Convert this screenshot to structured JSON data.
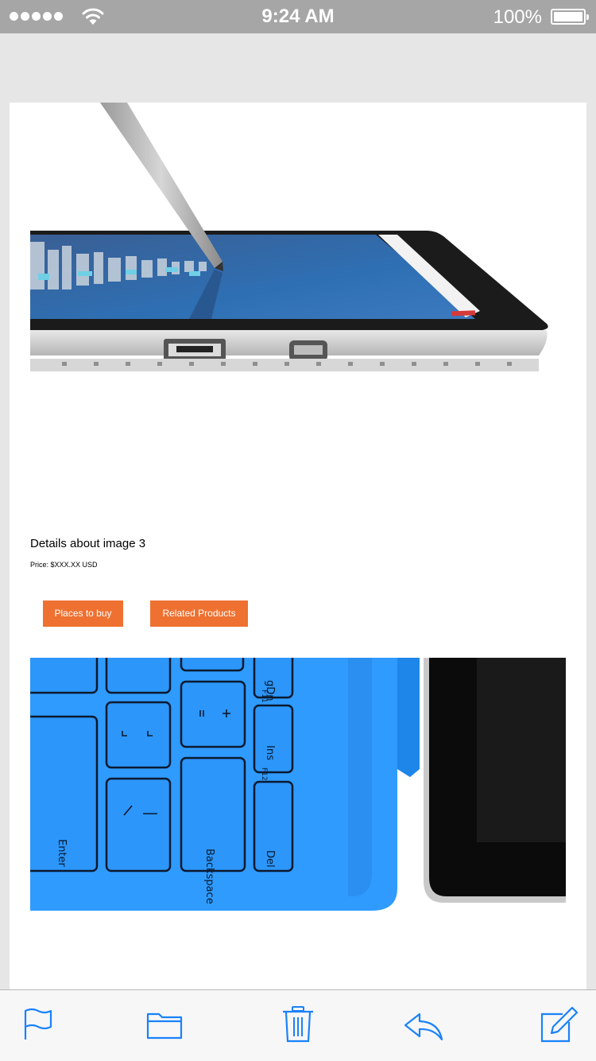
{
  "status_bar": {
    "time": "9:24 AM",
    "battery_percent": "100%",
    "battery_level": 1.0,
    "signal_icon": "signal-dots-icon",
    "wifi_icon": "wifi-icon",
    "battery_icon": "battery-icon"
  },
  "product": {
    "image1_icon": "tablet-with-pen-image",
    "details_title": "Details about image 3",
    "price": "Price: $XXX.XX USD",
    "places_button": "Places to buy",
    "related_button": "Related Products",
    "image2_icon": "keyboard-cover-image",
    "keyboard_keys": {
      "enter": "Enter",
      "backspace": "Backspace",
      "del": "Del",
      "ins": "Ins",
      "f12": "F12",
      "f11": "F11",
      "pgdn": "gDn"
    }
  },
  "toolbar": {
    "items": [
      {
        "icon": "flag-icon"
      },
      {
        "icon": "folder-icon"
      },
      {
        "icon": "trash-icon"
      },
      {
        "icon": "reply-icon"
      },
      {
        "icon": "compose-icon"
      }
    ]
  },
  "colors": {
    "accent": "#1a82fb",
    "button": "#ee7131",
    "status_bar": "#a6a6a6",
    "keyboard_blue": "#2f9bff"
  }
}
